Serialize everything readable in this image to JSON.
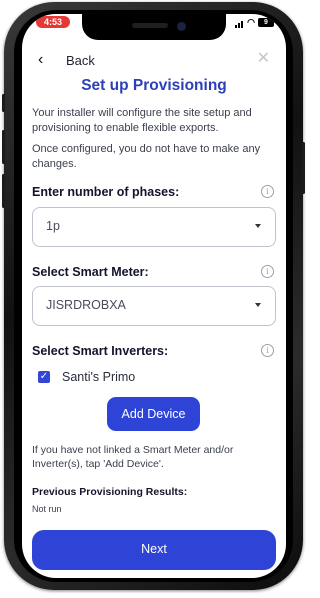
{
  "status_bar": {
    "time": "4:53",
    "battery": "9"
  },
  "header": {
    "back_label": "Back"
  },
  "title": "Set up Provisioning",
  "intro": {
    "paragraph1": "Your installer will configure the site setup and provisioning to enable flexible exports.",
    "paragraph2": "Once configured, you do not have to make any changes."
  },
  "phases": {
    "label": "Enter number of phases:",
    "value": "1p"
  },
  "smart_meter": {
    "label": "Select Smart Meter:",
    "value": "JISRDROBXA"
  },
  "inverters": {
    "label": "Select Smart Inverters:",
    "items": [
      {
        "label": "Santi's Primo",
        "checked": true
      }
    ]
  },
  "add_device": {
    "label": "Add Device"
  },
  "hint": "If you have not linked a Smart Meter and/or Inverter(s), tap 'Add Device'.",
  "previous_results": {
    "label": "Previous Provisioning Results:",
    "value": "Not run"
  },
  "next": {
    "label": "Next"
  },
  "colors": {
    "accent": "#2e44d6",
    "title": "#2c3fb8",
    "status_time_bg": "#e53935"
  }
}
